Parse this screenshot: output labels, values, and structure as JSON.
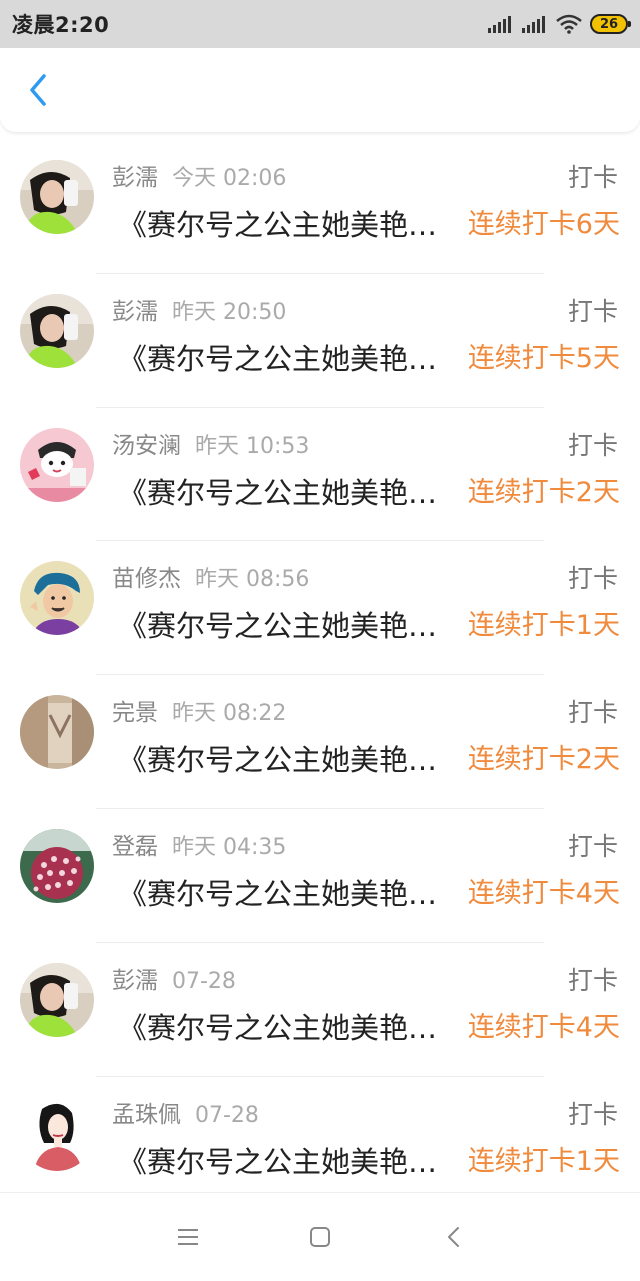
{
  "status_bar": {
    "time": "凌晨2:20",
    "battery": "26"
  },
  "nav": {
    "back_icon": "chevron-left-icon",
    "accent_color": "#2f9bf0"
  },
  "colors": {
    "streak": "#f08a3c",
    "name": "#888888",
    "title": "#222222"
  },
  "items": [
    {
      "name": "彭濡",
      "time": "今天 02:06",
      "tag": "打卡",
      "title": "《赛尔号之公主她美艳无双》",
      "streak": "连续打卡6天",
      "avatar": "avatar-girl-green"
    },
    {
      "name": "彭濡",
      "time": "昨天 20:50",
      "tag": "打卡",
      "title": "《赛尔号之公主她美艳无双》",
      "streak": "连续打卡5天",
      "avatar": "avatar-girl-green"
    },
    {
      "name": "汤安澜",
      "time": "昨天 10:53",
      "tag": "打卡",
      "title": "《赛尔号之公主她美艳无双》",
      "streak": "连续打卡2天",
      "avatar": "avatar-cartoon-pink"
    },
    {
      "name": "苗修杰",
      "time": "昨天 08:56",
      "tag": "打卡",
      "title": "《赛尔号之公主她美艳无双》",
      "streak": "连续打卡1天",
      "avatar": "avatar-cartoon-man"
    },
    {
      "name": "完景",
      "time": "昨天 08:22",
      "tag": "打卡",
      "title": "《赛尔号之公主她美艳无双》",
      "streak": "连续打卡2天",
      "avatar": "avatar-photo-beige"
    },
    {
      "name": "登磊",
      "time": "昨天 04:35",
      "tag": "打卡",
      "title": "《赛尔号之公主她美艳无双》",
      "streak": "连续打卡4天",
      "avatar": "avatar-flower"
    },
    {
      "name": "彭濡",
      "time": "07-28",
      "tag": "打卡",
      "title": "《赛尔号之公主她美艳无双》",
      "streak": "连续打卡4天",
      "avatar": "avatar-girl-green"
    },
    {
      "name": "孟珠佩",
      "time": "07-28",
      "tag": "打卡",
      "title": "《赛尔号之公主她美艳无双》",
      "streak": "连续打卡1天",
      "avatar": "avatar-sketch-woman"
    }
  ],
  "system_nav": {
    "menu_icon": "menu-icon",
    "home_icon": "home-square-icon",
    "back_icon": "back-triangle-icon"
  }
}
